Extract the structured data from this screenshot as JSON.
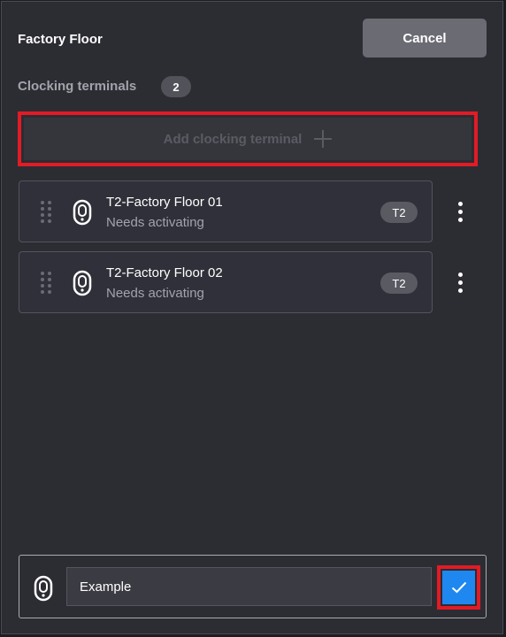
{
  "header": {
    "title": "Factory Floor",
    "cancel_label": "Cancel"
  },
  "section": {
    "label": "Clocking terminals",
    "count": "2"
  },
  "add_button": {
    "label": "Add clocking terminal",
    "icon": "plus-icon"
  },
  "terminals": [
    {
      "name": "T2-Factory Floor 01",
      "status": "Needs activating",
      "type": "T2",
      "icon": "clocking-terminal-icon"
    },
    {
      "name": "T2-Factory Floor 02",
      "status": "Needs activating",
      "type": "T2",
      "icon": "clocking-terminal-icon"
    }
  ],
  "new_terminal": {
    "value": "Example",
    "icon": "clocking-terminal-icon",
    "confirm_icon": "check-icon"
  },
  "colors": {
    "background": "#2c2c33",
    "highlight": "#e21b25",
    "confirm": "#1e88f0",
    "cancel": "#6b6b74"
  }
}
